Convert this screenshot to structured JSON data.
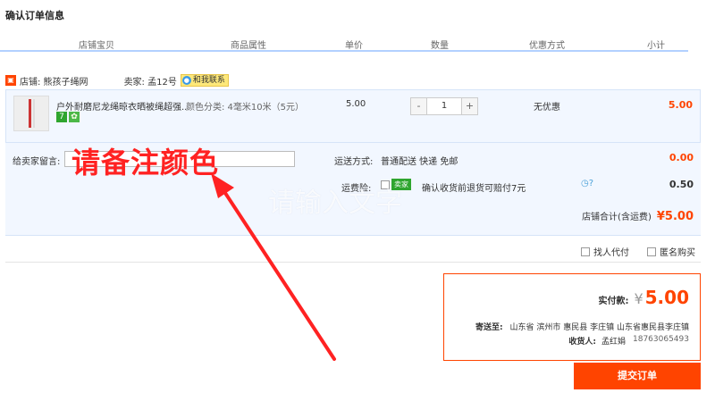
{
  "page_title": "确认订单信息",
  "columns": [
    "店铺宝贝",
    "商品属性",
    "单价",
    "数量",
    "优惠方式",
    "小计"
  ],
  "shop": {
    "icon": "shop-icon",
    "name": "店铺: 熊孩子绳网",
    "seller": "卖家: 孟12号",
    "contact_label": "和我联系"
  },
  "item": {
    "title": "户外耐磨尼龙绳晾衣晒被绳超强...",
    "attr": "颜色分类: 4毫米10米（5元）",
    "price": "5.00",
    "quantity": "1",
    "minus": "-",
    "plus": "+",
    "promo": "无优惠",
    "subtotal": "5.00",
    "badge1": "7"
  },
  "message": {
    "label": "给卖家留言:"
  },
  "shipping": {
    "label": "运送方式:",
    "value": "普通配送 快递 免邮",
    "fee": "0.00"
  },
  "insurance": {
    "label": "运费险:",
    "tag": "卖家",
    "text": "确认收货前退货可赔付7元",
    "fee": "0.50"
  },
  "shop_total": {
    "label": "店铺合计(含运费)",
    "value": "¥5.00"
  },
  "options": {
    "proxy_pay": "找人代付",
    "anonymous": "匿名购买"
  },
  "payment": {
    "label": "实付款:",
    "currency": "¥",
    "value": "5.00",
    "address_label": "寄送至:",
    "address": "山东省 滨州市 惠民县 李庄镇 山东省惠民县李庄镇",
    "receiver_label": "收货人:",
    "receiver": "孟红娟",
    "phone": "18763065493"
  },
  "submit_label": "提交订单",
  "annotation": "请备注颜色",
  "watermark": "请输入文字",
  "colors": {
    "accent": "#ff4400",
    "row_bg": "#f2f7ff",
    "header_line": "#b2d1ff",
    "annotation": "#ff2222"
  }
}
